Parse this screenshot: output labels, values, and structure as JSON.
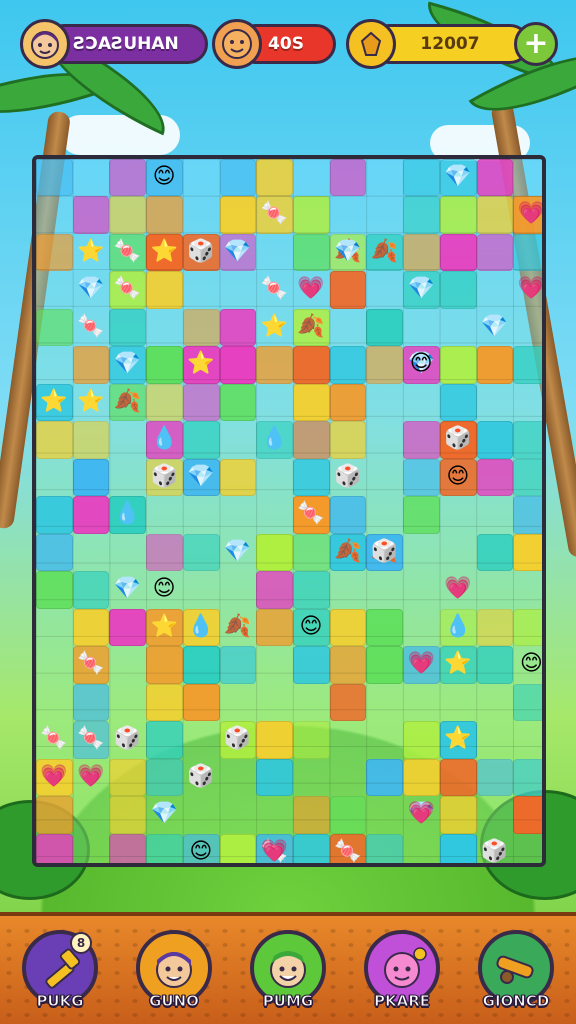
{
  "hud": {
    "player_name": "ƧƆAƧUHAN",
    "moves": "40S",
    "coins": "12007",
    "avatar_icon": "player-avatar-icon",
    "moves_icon": "moves-face-icon",
    "coins_icon": "coin-icon",
    "plus_label": "+"
  },
  "colors": {
    "name_pill": "#7b2fa0",
    "moves_pill": "#e8362a",
    "coins_pill": "#f5cf22",
    "plus_button": "#7cc83a"
  },
  "boosters": [
    {
      "label": "PUKG",
      "icon": "hammer-icon",
      "count": "8",
      "color": "#6a3fb5"
    },
    {
      "label": "GUNO",
      "icon": "kid-face-icon",
      "count": "",
      "color": "#f0a020"
    },
    {
      "label": "PUMG",
      "icon": "elf-face-icon",
      "count": "",
      "color": "#5cc83a"
    },
    {
      "label": "PKARE",
      "icon": "pink-face-icon",
      "count": "",
      "color": "#c050d8"
    },
    {
      "label": "GIONCD",
      "icon": "cannon-icon",
      "count": "",
      "color": "#3aaa5a"
    }
  ]
}
